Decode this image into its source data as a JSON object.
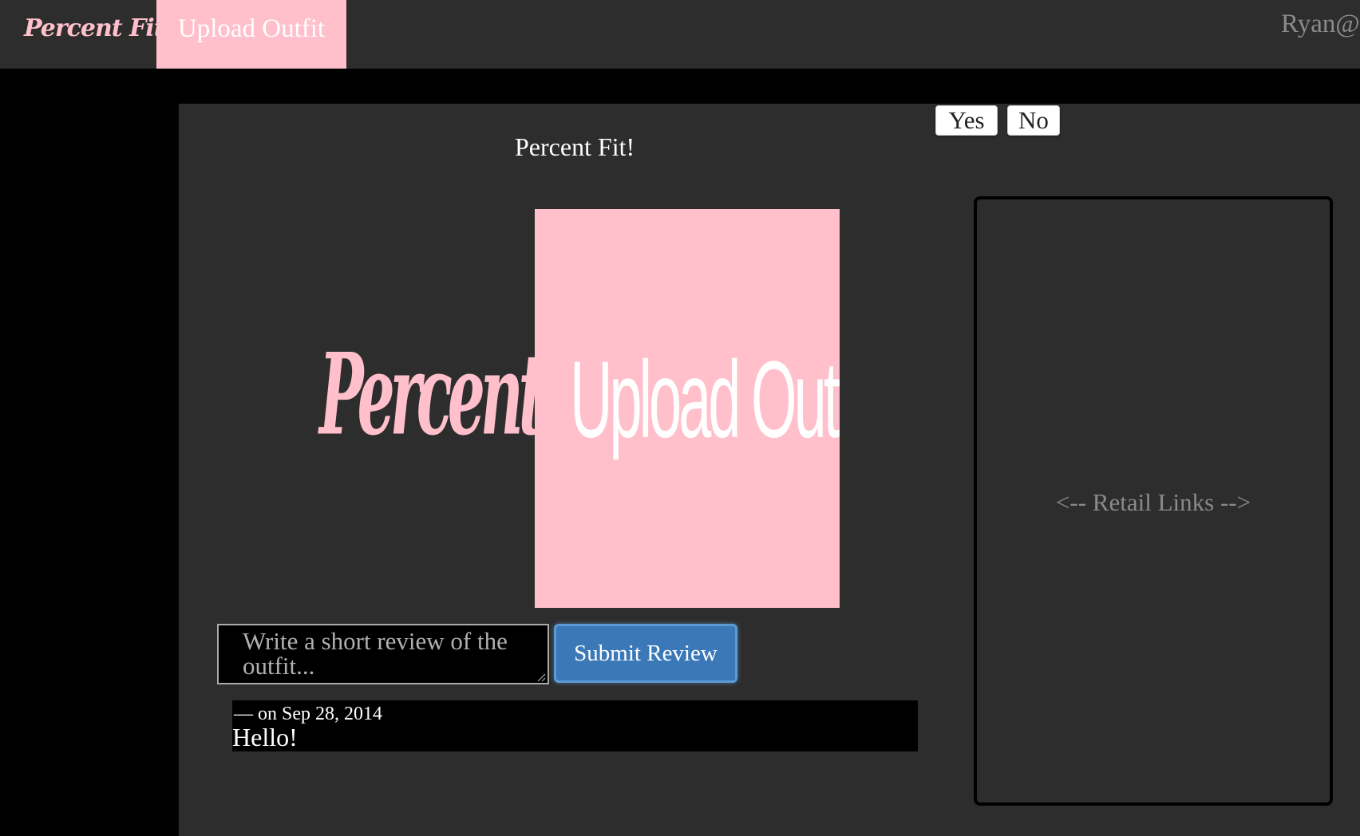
{
  "nav": {
    "brand": "Percent Fit",
    "upload": "Upload Outfit",
    "user": "Ryan@"
  },
  "main": {
    "title": "Percent Fit!",
    "vote": {
      "yes": "Yes",
      "no": "No"
    },
    "logo_text": "Percent Fit",
    "outfit_text": "Upload Outfit",
    "review_placeholder": "Write a short review of the outfit...",
    "submit_label": "Submit Review",
    "comment": {
      "meta": "— on Sep 28, 2014",
      "body": "Hello!"
    }
  },
  "retail": {
    "label": "<-- Retail Links -->"
  },
  "colors": {
    "accent": "#ffc0cb",
    "panel": "#2d2d2d",
    "button_blue": "#3a78b8"
  }
}
